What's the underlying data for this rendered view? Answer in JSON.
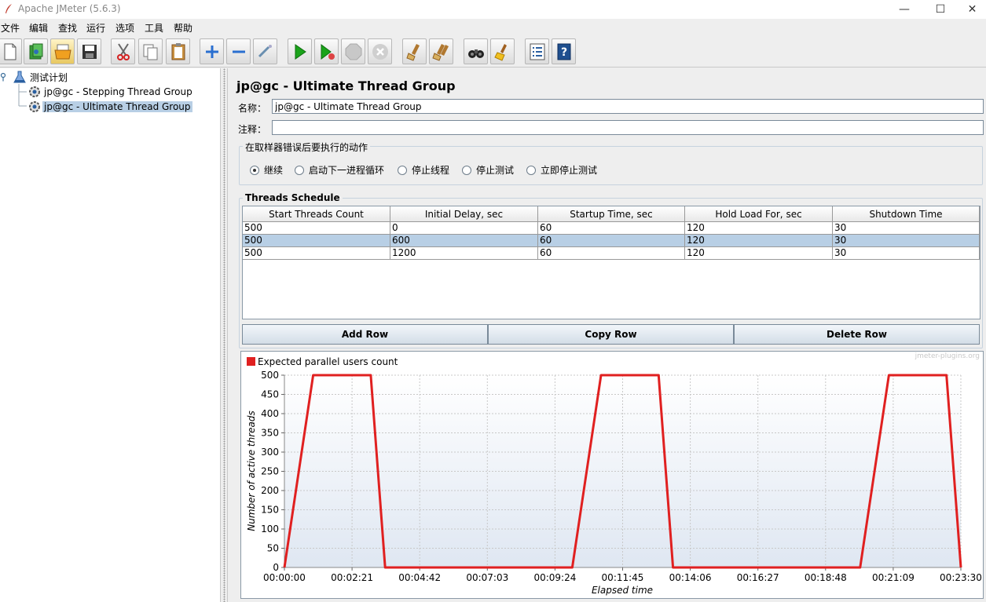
{
  "window": {
    "title": "Apache JMeter (5.6.3)",
    "minimize_glyph": "—",
    "maximize_glyph": "☐",
    "close_glyph": "✕"
  },
  "menu": [
    "文件",
    "编辑",
    "查找",
    "运行",
    "选项",
    "工具",
    "帮助"
  ],
  "toolbar": {
    "icons": [
      "new-icon",
      "templates-icon",
      "open-icon",
      "save-icon",
      "cut-icon",
      "copy-icon",
      "paste-icon",
      "expand-icon",
      "collapse-icon",
      "toggle-icon",
      "start-icon",
      "start-no-pause-icon",
      "stop-icon",
      "shutdown-icon",
      "clear-icon",
      "clear-all-icon",
      "search-icon",
      "reset-search-icon",
      "function-helper-icon",
      "help-icon"
    ]
  },
  "tree": {
    "root": "测试计划",
    "children": [
      "jp@gc - Stepping Thread Group",
      "jp@gc - Ultimate Thread Group"
    ],
    "selected_index": 1
  },
  "panel": {
    "title": "jp@gc - Ultimate Thread Group",
    "name_label": "名称：",
    "name_value": "jp@gc - Ultimate Thread Group",
    "comment_label": "注释：",
    "comment_value": "",
    "error_action": {
      "title": "在取样器错误后要执行的动作",
      "options": [
        "继续",
        "启动下一进程循环",
        "停止线程",
        "停止测试",
        "立即停止测试"
      ],
      "selected": 0
    },
    "schedule": {
      "title": "Threads Schedule",
      "columns": [
        "Start Threads Count",
        "Initial Delay, sec",
        "Startup Time, sec",
        "Hold Load For, sec",
        "Shutdown Time"
      ],
      "rows": [
        [
          "500",
          "0",
          "60",
          "120",
          "30"
        ],
        [
          "500",
          "600",
          "60",
          "120",
          "30"
        ],
        [
          "500",
          "1200",
          "60",
          "120",
          "30"
        ]
      ],
      "selected_row": 1,
      "buttons": {
        "add": "Add Row",
        "copy": "Copy Row",
        "delete": "Delete Row"
      }
    }
  },
  "chart_data": {
    "type": "line",
    "legend": "Expected parallel users count",
    "watermark": "jmeter-plugins.org",
    "xlabel": "Elapsed time",
    "ylabel": "Number of active threads",
    "ylim": [
      0,
      500
    ],
    "xlim_seconds": [
      0,
      1410
    ],
    "yticks": [
      0,
      50,
      100,
      150,
      200,
      250,
      300,
      350,
      400,
      450,
      500
    ],
    "xtick_labels": [
      "00:00:00",
      "00:02:21",
      "00:04:42",
      "00:07:03",
      "00:09:24",
      "00:11:45",
      "00:14:06",
      "00:16:27",
      "00:18:48",
      "00:21:09",
      "00:23:30"
    ],
    "color": "#e02020",
    "series": [
      {
        "x": [
          0,
          60,
          180,
          210,
          600,
          660,
          780,
          810,
          1200,
          1260,
          1380,
          1410
        ],
        "y": [
          0,
          500,
          500,
          0,
          0,
          500,
          500,
          0,
          0,
          500,
          500,
          0
        ]
      }
    ]
  }
}
